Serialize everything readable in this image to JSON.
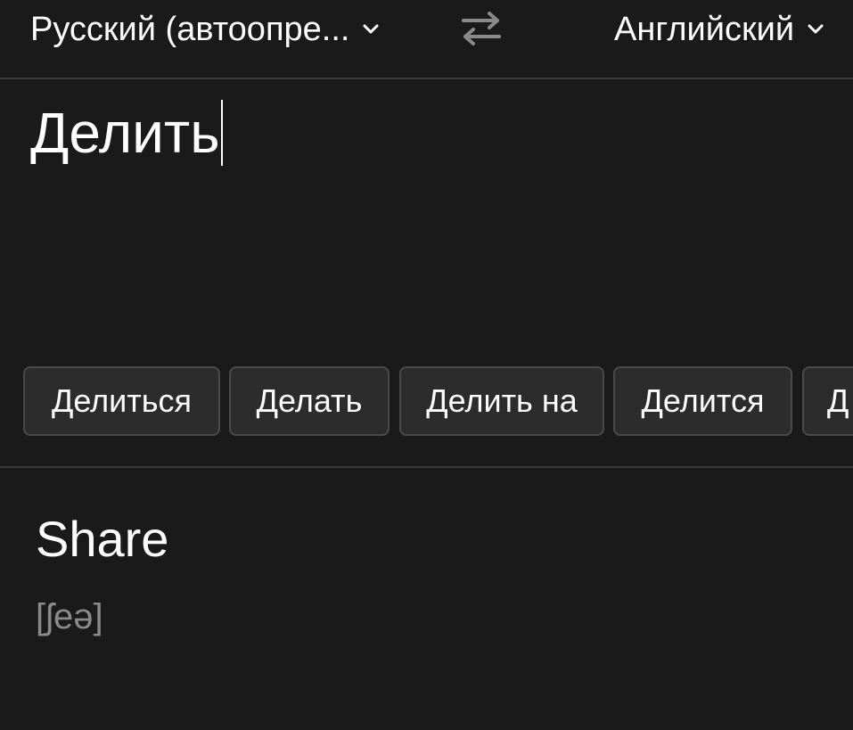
{
  "lang_bar": {
    "source_lang": "Русский (автоопре...",
    "target_lang": "Английский",
    "chevron_icon": "chevron-down-icon",
    "swap_icon": "swap-arrows-icon"
  },
  "input": {
    "text": "Делить"
  },
  "suggestions": [
    "Делиться",
    "Делать",
    "Делить на",
    "Делится",
    "Д"
  ],
  "result": {
    "translation": "Share",
    "transcription": "[ʃeə]"
  },
  "colors": {
    "background": "#1a1a1a",
    "chip_background": "#2c2c2c",
    "chip_border": "#4a4a4a",
    "divider": "#3a3a3a",
    "transcription": "#8a8a8a"
  }
}
